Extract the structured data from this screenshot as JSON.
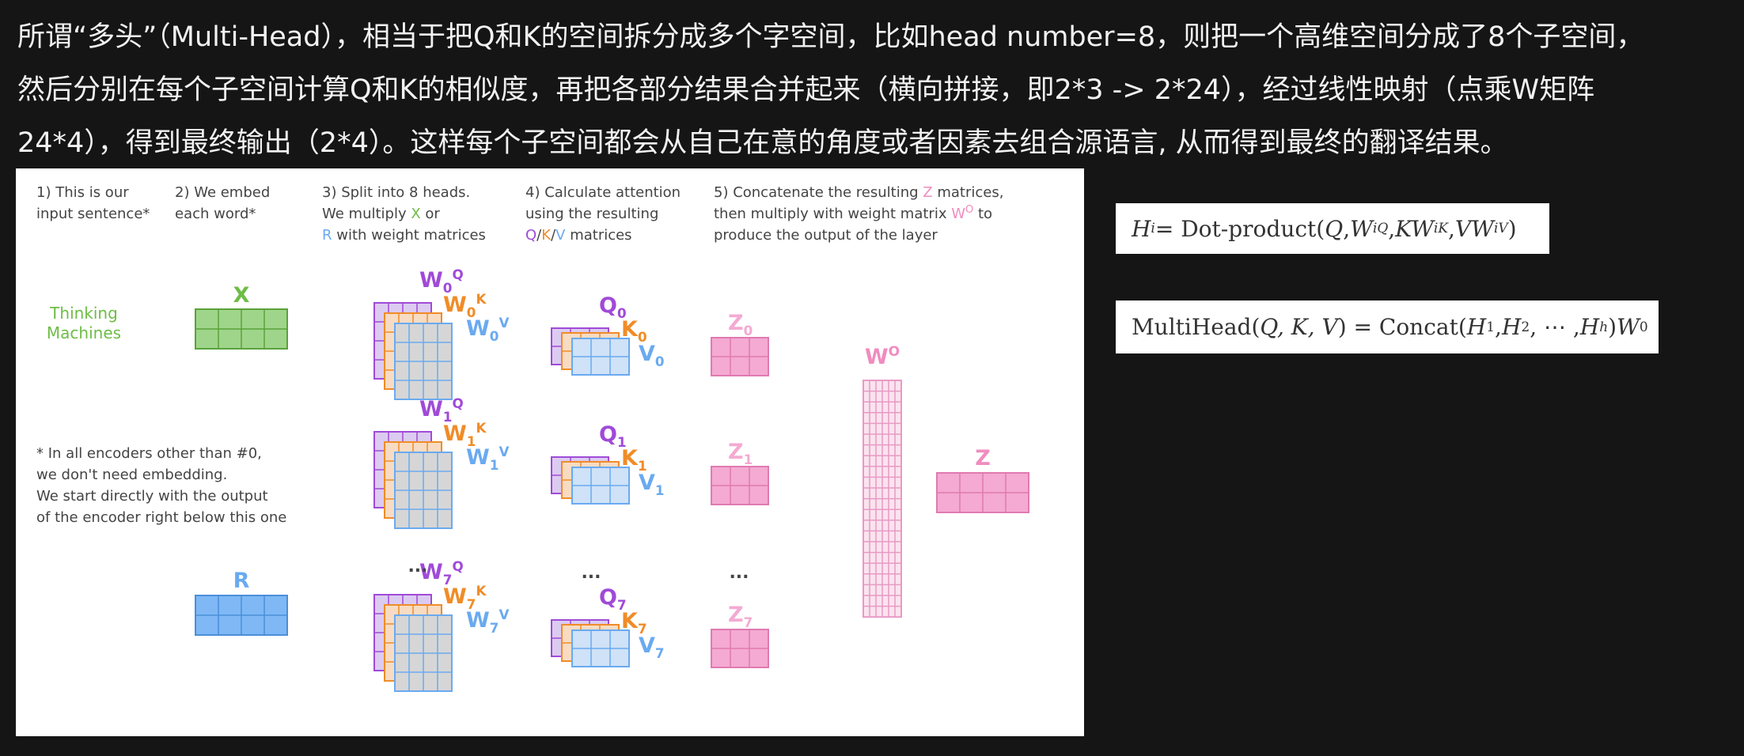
{
  "intro": {
    "line1": "所谓“多头”（Multi-Head），相当于把Q和K的空间拆分成多个字空间，比如head number=8，则把一个高维空间分成了8个子空间，",
    "line2": "然后分别在每个子空间计算Q和K的相似度，再把各部分结果合并起来（横向拼接，即2*3 -> 2*24），经过线性映射（点乘W矩阵",
    "line3": "24*4），得到最终输出（2*4）。这样每个子空间都会从自己在意的角度或者因素去组合源语言, 从而得到最终的翻译结果。"
  },
  "steps": {
    "s1": [
      "1) This is our",
      "input sentence*"
    ],
    "s2": [
      "2) We embed",
      "each word*"
    ],
    "s3a": "3) Split into 8 heads.",
    "s3b_pre": "We multiply ",
    "s3b_x": "X",
    "s3b_post": " or",
    "s3c_r": "R",
    "s3c_post": " with weight matrices",
    "s4a": "4) Calculate attention",
    "s4b": "using the resulting",
    "s4c_q": "Q",
    "s4c_slash1": "/",
    "s4c_k": "K",
    "s4c_slash2": "/",
    "s4c_v": "V",
    "s4c_post": " matrices",
    "s5a_pre": "5) Concatenate the resulting ",
    "s5a_z": "Z",
    "s5a_post": " matrices,",
    "s5b_pre": "then multiply with weight matrix ",
    "s5b_w": "W",
    "s5b_o": "O",
    "s5b_post": " to",
    "s5c": "produce the output of the layer"
  },
  "input_sentence": [
    "Thinking",
    "Machines"
  ],
  "footnote": [
    "* In all encoders other than #0,",
    "we don't need embedding.",
    "We start directly with the output",
    "of the encoder right below this one"
  ],
  "labels": {
    "x": "X",
    "r": "R",
    "w": "W",
    "q": "Q",
    "k": "K",
    "v": "V",
    "z": "Z",
    "o": "O",
    "head_indices": [
      "0",
      "1",
      "7"
    ],
    "ellipsis": "..."
  },
  "formulas": {
    "f1_lhs": "H",
    "f1_lhs_sub": "i",
    "f1_eq": " = Dot-product(",
    "f1_q": "Q",
    "f1_c1": ", ",
    "f1_w1": "W",
    "f1_w1_sub": "i",
    "f1_w1_sup": "Q",
    "f1_c2": ", ",
    "f1_k": "KW",
    "f1_w2_sub": "i",
    "f1_w2_sup": "K",
    "f1_c3": ", ",
    "f1_v": "VW",
    "f1_w3_sub": "i",
    "f1_w3_sup": "V",
    "f1_close": ")",
    "f2_name": "MultiHead(",
    "f2_args": "Q, K, V",
    "f2_eq": ") = Concat(",
    "f2_h1": "H",
    "f2_h1_sub": "1",
    "f2_c1": ", ",
    "f2_h2": "H",
    "f2_h2_sub": "2",
    "f2_dots": ", ⋯ , ",
    "f2_hh": "H",
    "f2_hh_sub": "h",
    "f2_close": ")",
    "f2_w": "W",
    "f2_w_sup": "0"
  },
  "colors": {
    "green": "#6dbd45",
    "green_fill": "#9fd58a",
    "blue": "#6aaaf0",
    "blue_fill": "#7fb8f5",
    "purple": "#a04ad8",
    "orange": "#f08c28",
    "pink": "#f08cbe",
    "pink_fill": "#f4aad2"
  }
}
